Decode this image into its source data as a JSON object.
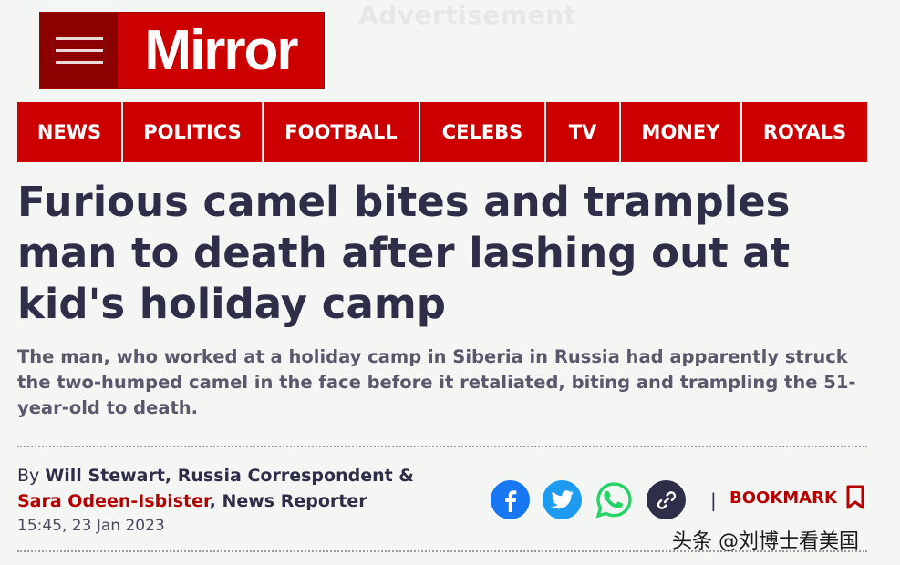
{
  "ad": {
    "label": "Advertisement"
  },
  "logo": {
    "brand": "Mirror"
  },
  "nav": {
    "items": [
      {
        "label": "NEWS"
      },
      {
        "label": "POLITICS"
      },
      {
        "label": "FOOTBALL"
      },
      {
        "label": "CELEBS"
      },
      {
        "label": "TV"
      },
      {
        "label": "MONEY"
      },
      {
        "label": "ROYALS"
      }
    ]
  },
  "article": {
    "headline": "Furious camel bites and tramples man to death after lashing out at kid's holiday camp",
    "standfirst": "The man, who worked at a holiday camp in Siberia in Russia had apparently struck the two-humped camel in the face before it retaliated, biting and trampling the 51-year-old to death.",
    "byline": {
      "by": "By ",
      "author1": "Will Stewart",
      "author1_role": ", Russia Correspondent &",
      "author2": "Sara Odeen-Isbister",
      "author2_role": ", News Reporter"
    },
    "timestamp": "15:45, 23 Jan 2023"
  },
  "share": {
    "facebook_icon": "facebook-icon",
    "twitter_icon": "twitter-icon",
    "whatsapp_icon": "whatsapp-icon",
    "link_icon": "link-icon",
    "separator": "|",
    "bookmark_label": "BOOKMARK"
  },
  "watermark": {
    "text": "头条 @刘博士看美国"
  },
  "colors": {
    "brand_red": "#cc0000",
    "menu_dark_red": "#8d0000",
    "headline": "#2f2e49",
    "facebook": "#1877f2",
    "twitter": "#1d9bf0",
    "whatsapp": "#25d366",
    "link": "#2f2e49"
  }
}
